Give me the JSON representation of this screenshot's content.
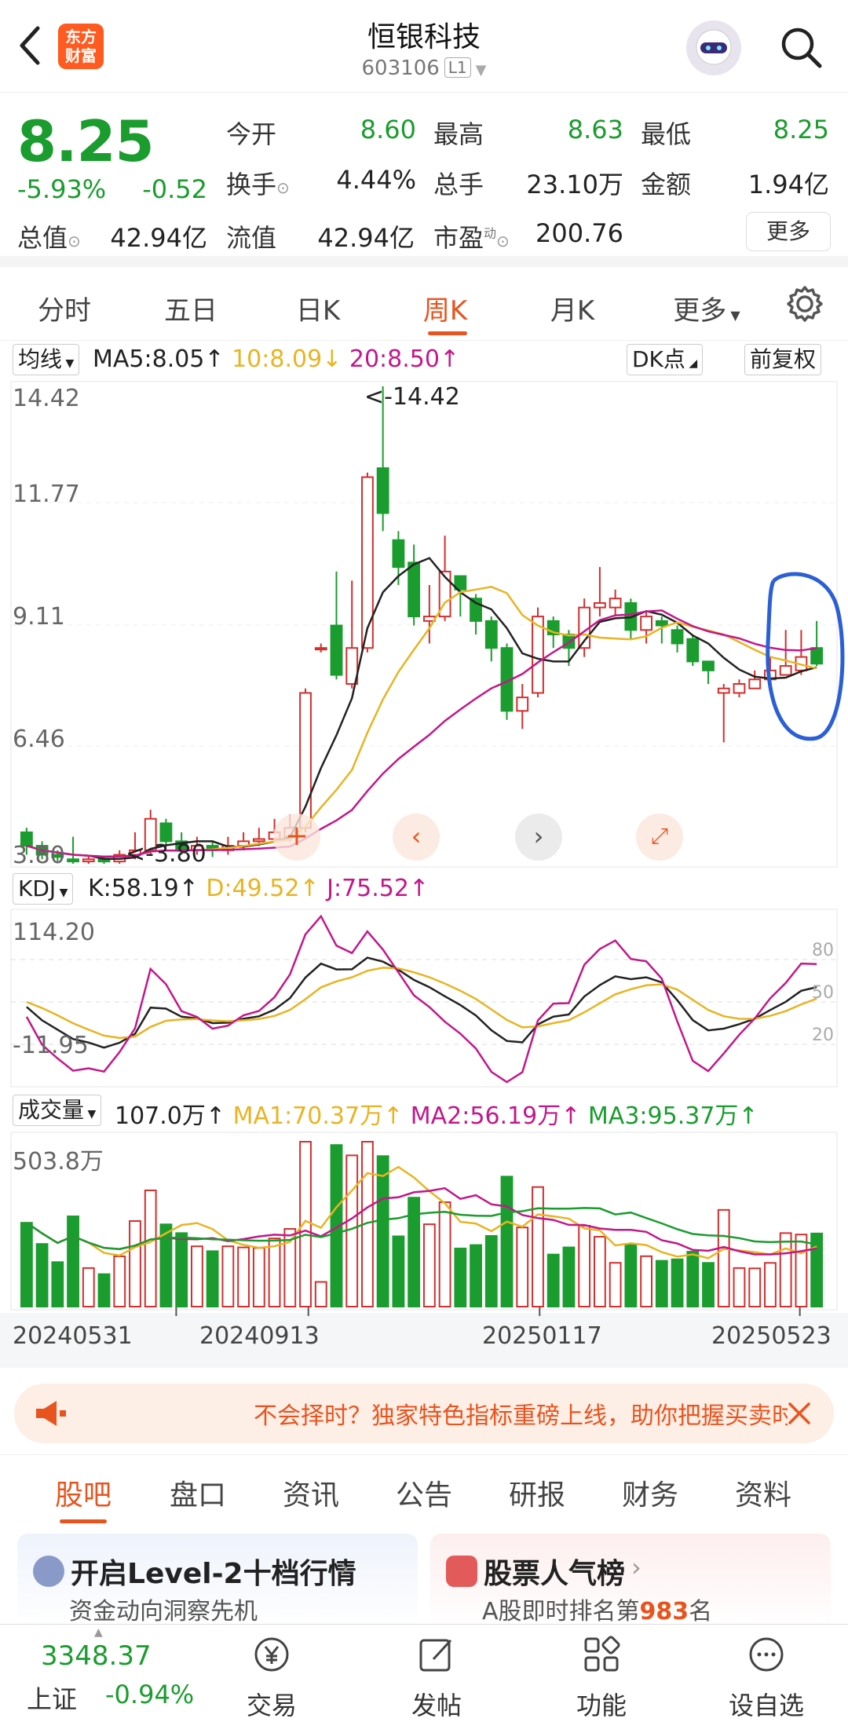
{
  "header": {
    "title": "恒银科技",
    "code": "603106",
    "level": "L1",
    "logo": "东方财富"
  },
  "quote": {
    "price": "8.25",
    "change_pct": "-5.93%",
    "change": "-0.52",
    "open_label": "今开",
    "open": "8.60",
    "high_label": "最高",
    "high": "8.63",
    "low_label": "最低",
    "low": "8.25",
    "turnover_label": "换手",
    "turnover": "4.44%",
    "volume_label": "总手",
    "volume": "23.10万",
    "amount_label": "金额",
    "amount": "1.94亿",
    "mcap_label": "总值",
    "mcap": "42.94亿",
    "float_label": "流值",
    "float": "42.94亿",
    "pe_label": "市盈",
    "pe_sup": "动",
    "pe": "200.76",
    "more": "更多"
  },
  "period_tabs": [
    "分时",
    "五日",
    "日K",
    "周K",
    "月K",
    "更多"
  ],
  "ma": {
    "select": "均线",
    "ma5": "MA5:8.05",
    "ma10": "10:8.09",
    "ma20": "20:8.50",
    "dk": "DK点",
    "adjust": "前复权"
  },
  "price_axis": [
    "14.42",
    "11.77",
    "9.11",
    "6.46",
    "3.80"
  ],
  "max_label": "<-14.42",
  "min_label": "<-3.80",
  "kdj": {
    "select": "KDJ",
    "k": "K:58.19",
    "d": "D:49.52",
    "j": "J:75.52",
    "axis_top": "114.20",
    "axis_bottom": "-11.95",
    "ref": [
      "80",
      "50",
      "20"
    ]
  },
  "vol": {
    "select": "成交量",
    "value": "107.0万",
    "ma1": "MA1:70.37万",
    "ma2": "MA2:56.19万",
    "ma3": "MA3:95.37万",
    "axis_top": "503.8万"
  },
  "dates": [
    "20240531",
    "20240913",
    "20250117",
    "20250523"
  ],
  "banner": {
    "text": "不会择时？独家特色指标重磅上线，助你把握买卖时机"
  },
  "sub_tabs": [
    "股吧",
    "盘口",
    "资讯",
    "公告",
    "研报",
    "财务",
    "资料"
  ],
  "cards": [
    {
      "title": "开启Level-2十档行情",
      "sub": "资金动向洞察先机"
    },
    {
      "title": "股票人气榜",
      "sub_prefix": "A股即时排名第",
      "rank": "983",
      "sub_suffix": "名"
    }
  ],
  "index": {
    "value": "3348.37",
    "name": "上证",
    "change": "-0.94%"
  },
  "bottom_nav": [
    "交易",
    "发帖",
    "功能",
    "设自选"
  ],
  "colors": {
    "up": "#d32f2f",
    "down": "#1a9c2e",
    "accent": "#e8541e",
    "ma10": "#e8b422",
    "ma20": "#c2188a"
  },
  "chart_data": {
    "type": "candlestick",
    "period": "weekly",
    "candles": [
      [
        4.5,
        4.2,
        4.6,
        4.0
      ],
      [
        4.2,
        4.0,
        4.3,
        3.9
      ],
      [
        4.0,
        3.95,
        4.1,
        3.85
      ],
      [
        3.9,
        3.85,
        4.4,
        3.8
      ],
      [
        3.85,
        3.9,
        4.0,
        3.8
      ],
      [
        3.9,
        3.85,
        3.95,
        3.8
      ],
      [
        3.85,
        4.0,
        4.1,
        3.8
      ],
      [
        4.0,
        4.1,
        4.5,
        3.9
      ],
      [
        4.1,
        4.8,
        5.0,
        4.0
      ],
      [
        4.7,
        4.3,
        4.8,
        4.2
      ],
      [
        4.3,
        4.1,
        4.5,
        4.0
      ],
      [
        4.1,
        4.2,
        4.4,
        4.0
      ],
      [
        4.2,
        4.1,
        4.3,
        3.95
      ],
      [
        4.1,
        4.2,
        4.4,
        4.0
      ],
      [
        4.2,
        4.3,
        4.5,
        4.1
      ],
      [
        4.3,
        4.35,
        4.6,
        4.2
      ],
      [
        4.35,
        4.5,
        4.8,
        4.3
      ],
      [
        4.4,
        4.6,
        4.9,
        4.3
      ],
      [
        4.6,
        7.6,
        7.7,
        4.5
      ],
      [
        8.6,
        8.6,
        8.7,
        8.5
      ],
      [
        9.1,
        8.0,
        10.3,
        7.9
      ],
      [
        7.8,
        8.6,
        10.1,
        7.7
      ],
      [
        8.6,
        12.4,
        12.5,
        8.5
      ],
      [
        12.6,
        11.6,
        14.42,
        11.2
      ],
      [
        11.0,
        10.4,
        11.2,
        10.0
      ],
      [
        10.5,
        9.3,
        10.9,
        9.1
      ],
      [
        9.2,
        9.3,
        10.0,
        8.7
      ],
      [
        9.3,
        10.3,
        11.1,
        9.2
      ],
      [
        10.2,
        9.9,
        10.2,
        9.3
      ],
      [
        9.7,
        9.2,
        9.8,
        8.9
      ],
      [
        9.2,
        8.6,
        9.3,
        8.3
      ],
      [
        8.6,
        7.2,
        8.7,
        7.0
      ],
      [
        7.2,
        7.5,
        7.8,
        6.8
      ],
      [
        7.6,
        9.3,
        9.5,
        7.5
      ],
      [
        9.2,
        8.9,
        9.3,
        8.6
      ],
      [
        8.9,
        8.6,
        9.0,
        8.2
      ],
      [
        8.6,
        9.5,
        9.7,
        8.4
      ],
      [
        9.5,
        9.6,
        10.4,
        9.3
      ],
      [
        9.5,
        9.7,
        9.9,
        9.3
      ],
      [
        9.6,
        9.0,
        9.7,
        8.8
      ],
      [
        9.0,
        9.3,
        9.4,
        8.7
      ],
      [
        9.2,
        9.1,
        9.3,
        8.7
      ],
      [
        9.0,
        8.7,
        9.1,
        8.5
      ],
      [
        8.8,
        8.3,
        8.9,
        8.2
      ],
      [
        8.3,
        8.1,
        8.3,
        7.8
      ],
      [
        7.6,
        7.7,
        7.8,
        6.5
      ],
      [
        7.6,
        7.8,
        7.9,
        7.5
      ],
      [
        7.7,
        7.9,
        8.1,
        7.7
      ],
      [
        7.9,
        8.1,
        8.4,
        7.9
      ],
      [
        8.0,
        8.2,
        9.0,
        8.0
      ],
      [
        8.1,
        8.4,
        9.0,
        8.0
      ],
      [
        8.6,
        8.25,
        9.2,
        8.2
      ]
    ]
  }
}
